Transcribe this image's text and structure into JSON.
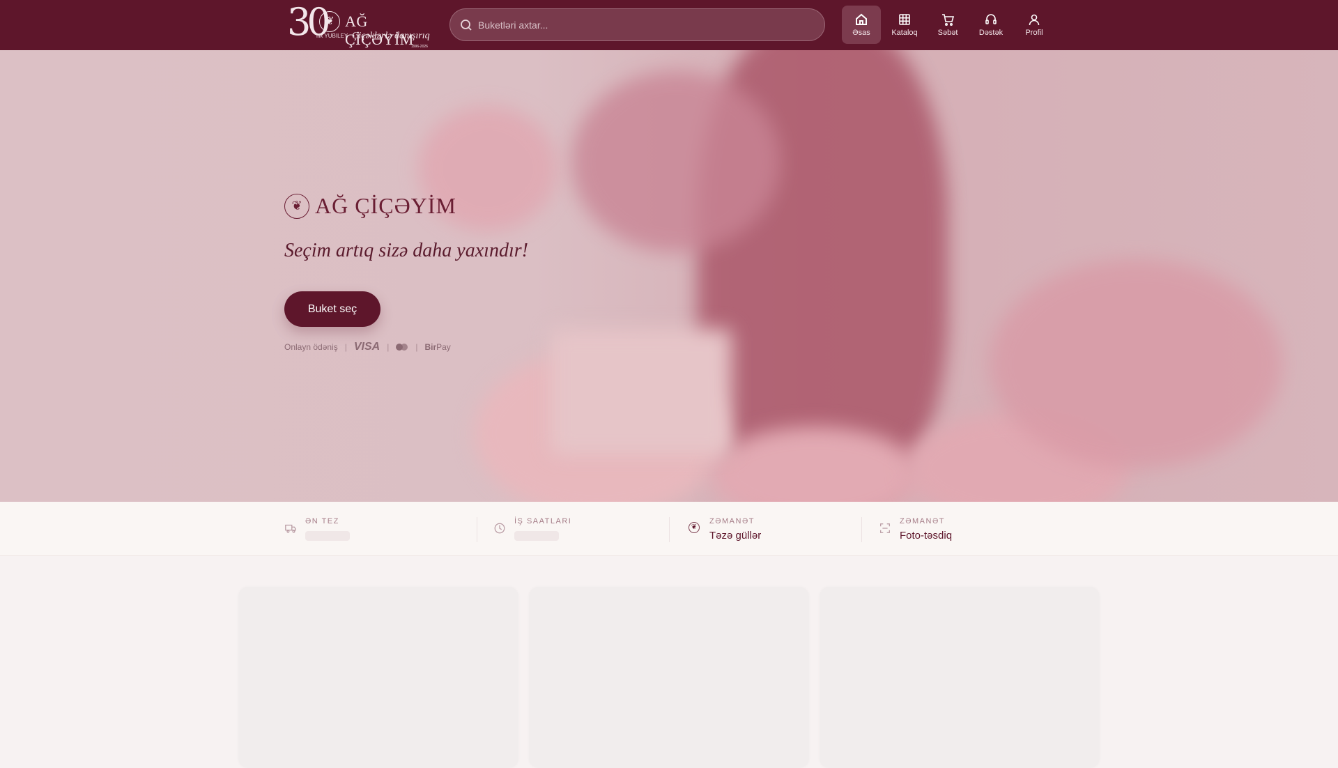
{
  "header": {
    "logo": {
      "number": "30",
      "jubilee": "ilik YUBILEY",
      "brand": "AĞ ÇİÇƏYİM",
      "slogan": "Çiçəklərlə danışırıq",
      "years": "1996-2026"
    },
    "search": {
      "placeholder": "Buketləri axtar..."
    },
    "nav": [
      {
        "label": "Əsas",
        "icon": "home-icon",
        "active": true
      },
      {
        "label": "Kataloq",
        "icon": "grid-icon"
      },
      {
        "label": "Səbət",
        "icon": "cart-icon"
      },
      {
        "label": "Dəstək",
        "icon": "headset-icon"
      },
      {
        "label": "Profil",
        "icon": "user-icon"
      }
    ]
  },
  "hero": {
    "brand": "AĞ ÇİÇƏYİM",
    "tagline": "Seçim artıq sizə daha yaxındır!",
    "cta": "Buket seç",
    "payment": {
      "label": "Onlayn ödəniş",
      "visa": "VISA",
      "birpay_bold": "Bir",
      "birpay_rest": "Pay"
    }
  },
  "info": [
    {
      "label": "ƏN TEZ",
      "value": null,
      "icon": "truck-icon"
    },
    {
      "label": "İŞ SAATLARI",
      "value": null,
      "icon": "clock-icon"
    },
    {
      "label": "ZƏMANƏT",
      "value": "Təzə güllər",
      "icon": "flower-icon"
    },
    {
      "label": "ZƏMANƏT",
      "value": "Foto-təsdiq",
      "icon": "scan-icon"
    }
  ],
  "colors": {
    "primary": "#5e162b",
    "background": "#f7f2f2"
  }
}
